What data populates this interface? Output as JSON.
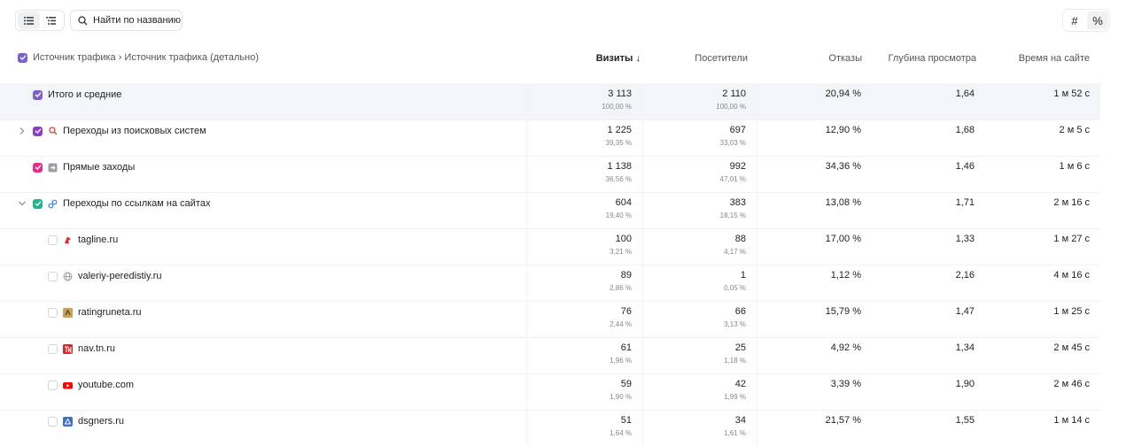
{
  "toolbar": {
    "search_placeholder": "Найти по названию",
    "unit_abs": "#",
    "unit_pct": "%"
  },
  "header": {
    "dimensions": "Источник трафика › Источник трафика (детально)",
    "columns": [
      "Визиты ↓",
      "Посетители",
      "Отказы",
      "Глубина просмотра",
      "Время на сайте"
    ]
  },
  "rows": [
    {
      "label": "Итого и средние",
      "visits": "3 113",
      "visits_pct": "100,00 %",
      "users": "2 110",
      "users_pct": "100,00 %",
      "bounce": "20,94 %",
      "depth": "1,64",
      "time": "1 м 52 с",
      "checkbox_color": "#7b61c9",
      "icon": "none"
    },
    {
      "label": "Переходы из поисковых систем",
      "visits": "1 225",
      "visits_pct": "39,35 %",
      "users": "697",
      "users_pct": "33,03 %",
      "bounce": "12,90 %",
      "depth": "1,68",
      "time": "2 м 5 с",
      "checkbox_color": "#8e3fc7",
      "icon": "search-icon"
    },
    {
      "label": "Прямые заходы",
      "visits": "1 138",
      "visits_pct": "36,56 %",
      "users": "992",
      "users_pct": "47,01 %",
      "bounce": "34,36 %",
      "depth": "1,46",
      "time": "1 м 6 с",
      "checkbox_color": "#e2308a",
      "icon": "direct-enter-icon"
    },
    {
      "label": "Переходы по ссылкам на сайтах",
      "visits": "604",
      "visits_pct": "19,40 %",
      "users": "383",
      "users_pct": "18,15 %",
      "bounce": "13,08 %",
      "depth": "1,71",
      "time": "2 м 16 с",
      "checkbox_color": "#1fb58f",
      "icon": "link-icon"
    },
    {
      "label": "tagline.ru",
      "visits": "100",
      "visits_pct": "3,21 %",
      "users": "88",
      "users_pct": "4,17 %",
      "bounce": "17,00 %",
      "depth": "1,33",
      "time": "1 м 27 с",
      "icon": "tagline-favicon"
    },
    {
      "label": "valeriy-peredistiy.ru",
      "visits": "89",
      "visits_pct": "2,86 %",
      "users": "1",
      "users_pct": "0,05 %",
      "bounce": "1,12 %",
      "depth": "2,16",
      "time": "4 м 16 с",
      "icon": "globe-icon"
    },
    {
      "label": "ratingruneta.ru",
      "visits": "76",
      "visits_pct": "2,44 %",
      "users": "66",
      "users_pct": "3,13 %",
      "bounce": "15,79 %",
      "depth": "1,47",
      "time": "1 м 25 с",
      "icon": "ratingruneta-favicon"
    },
    {
      "label": "nav.tn.ru",
      "visits": "61",
      "visits_pct": "1,96 %",
      "users": "25",
      "users_pct": "1,18 %",
      "bounce": "4,92 %",
      "depth": "1,34",
      "time": "2 м 45 с",
      "icon": "tn-favicon"
    },
    {
      "label": "youtube.com",
      "visits": "59",
      "visits_pct": "1,90 %",
      "users": "42",
      "users_pct": "1,99 %",
      "bounce": "3,39 %",
      "depth": "1,90",
      "time": "2 м 46 с",
      "icon": "youtube-favicon"
    },
    {
      "label": "dsgners.ru",
      "visits": "51",
      "visits_pct": "1,64 %",
      "users": "34",
      "users_pct": "1,61 %",
      "bounce": "21,57 %",
      "depth": "1,55",
      "time": "1 м 14 с",
      "icon": "dsgners-favicon"
    }
  ]
}
